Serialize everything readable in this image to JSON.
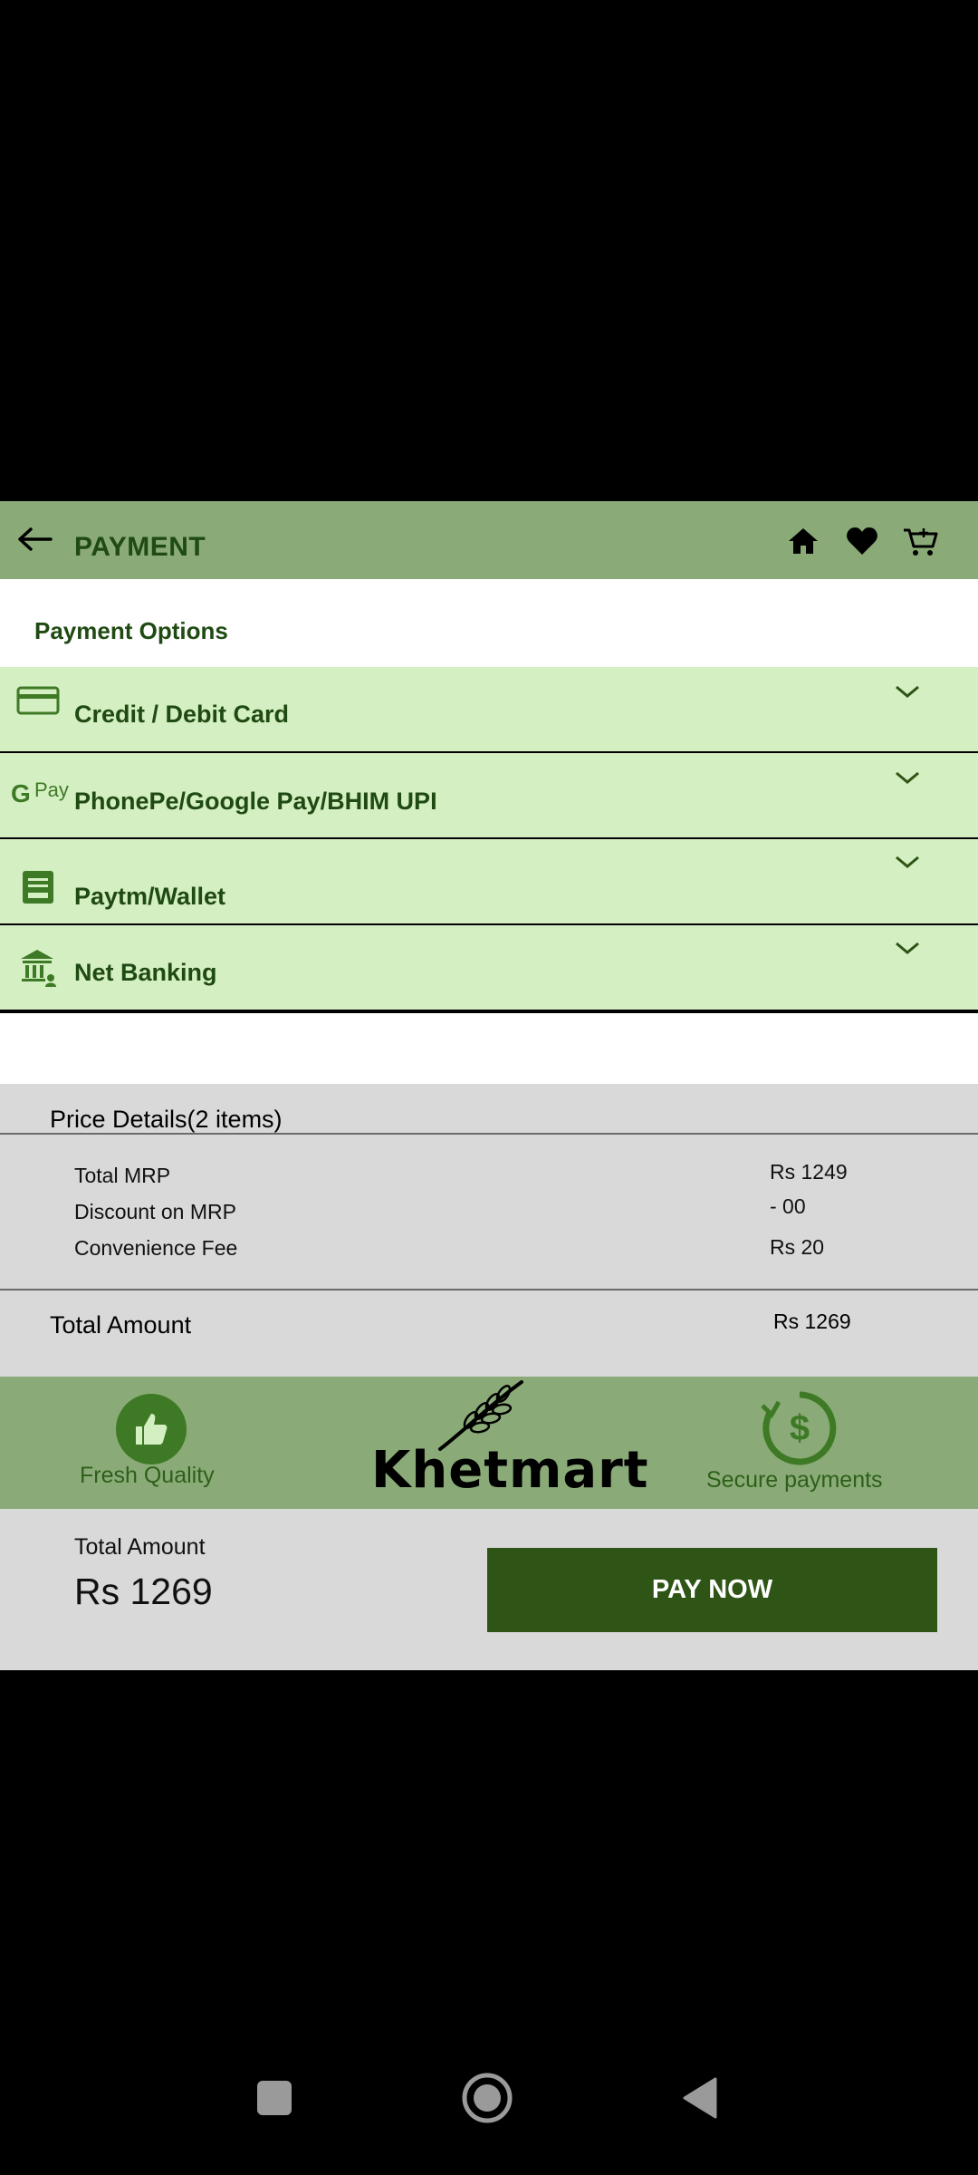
{
  "header": {
    "title": "PAYMENT"
  },
  "payment_options": {
    "title": "Payment Options",
    "items": [
      {
        "label": "Credit / Debit Card",
        "icon": "credit-card-icon"
      },
      {
        "label": "PhonePe/Google Pay/BHIM UPI",
        "icon": "gpay-icon",
        "icon_text": "Pay"
      },
      {
        "label": "Paytm/Wallet",
        "icon": "wallet-icon"
      },
      {
        "label": "Net Banking",
        "icon": "bank-icon"
      }
    ]
  },
  "price_details": {
    "title": "Price Details(2 items)",
    "rows": [
      {
        "label": "Total MRP",
        "value": "Rs 1249"
      },
      {
        "label": "Discount on MRP",
        "value": "- 00"
      },
      {
        "label": "Convenience Fee",
        "value": "Rs 20"
      }
    ],
    "total_label": "Total Amount",
    "total_value": "Rs 1269"
  },
  "banner": {
    "left_text": "Fresh Quality",
    "brand": "Khetmart",
    "right_text": "Secure payments"
  },
  "paybar": {
    "label": "Total Amount",
    "amount": "Rs 1269",
    "button": "PAY NOW"
  },
  "colors": {
    "header_bg": "#8aab77",
    "option_bg": "#d4efc2",
    "dark_green": "#1f4a12",
    "button_bg": "#2f5516",
    "panel_gray": "#d9d9d9"
  }
}
